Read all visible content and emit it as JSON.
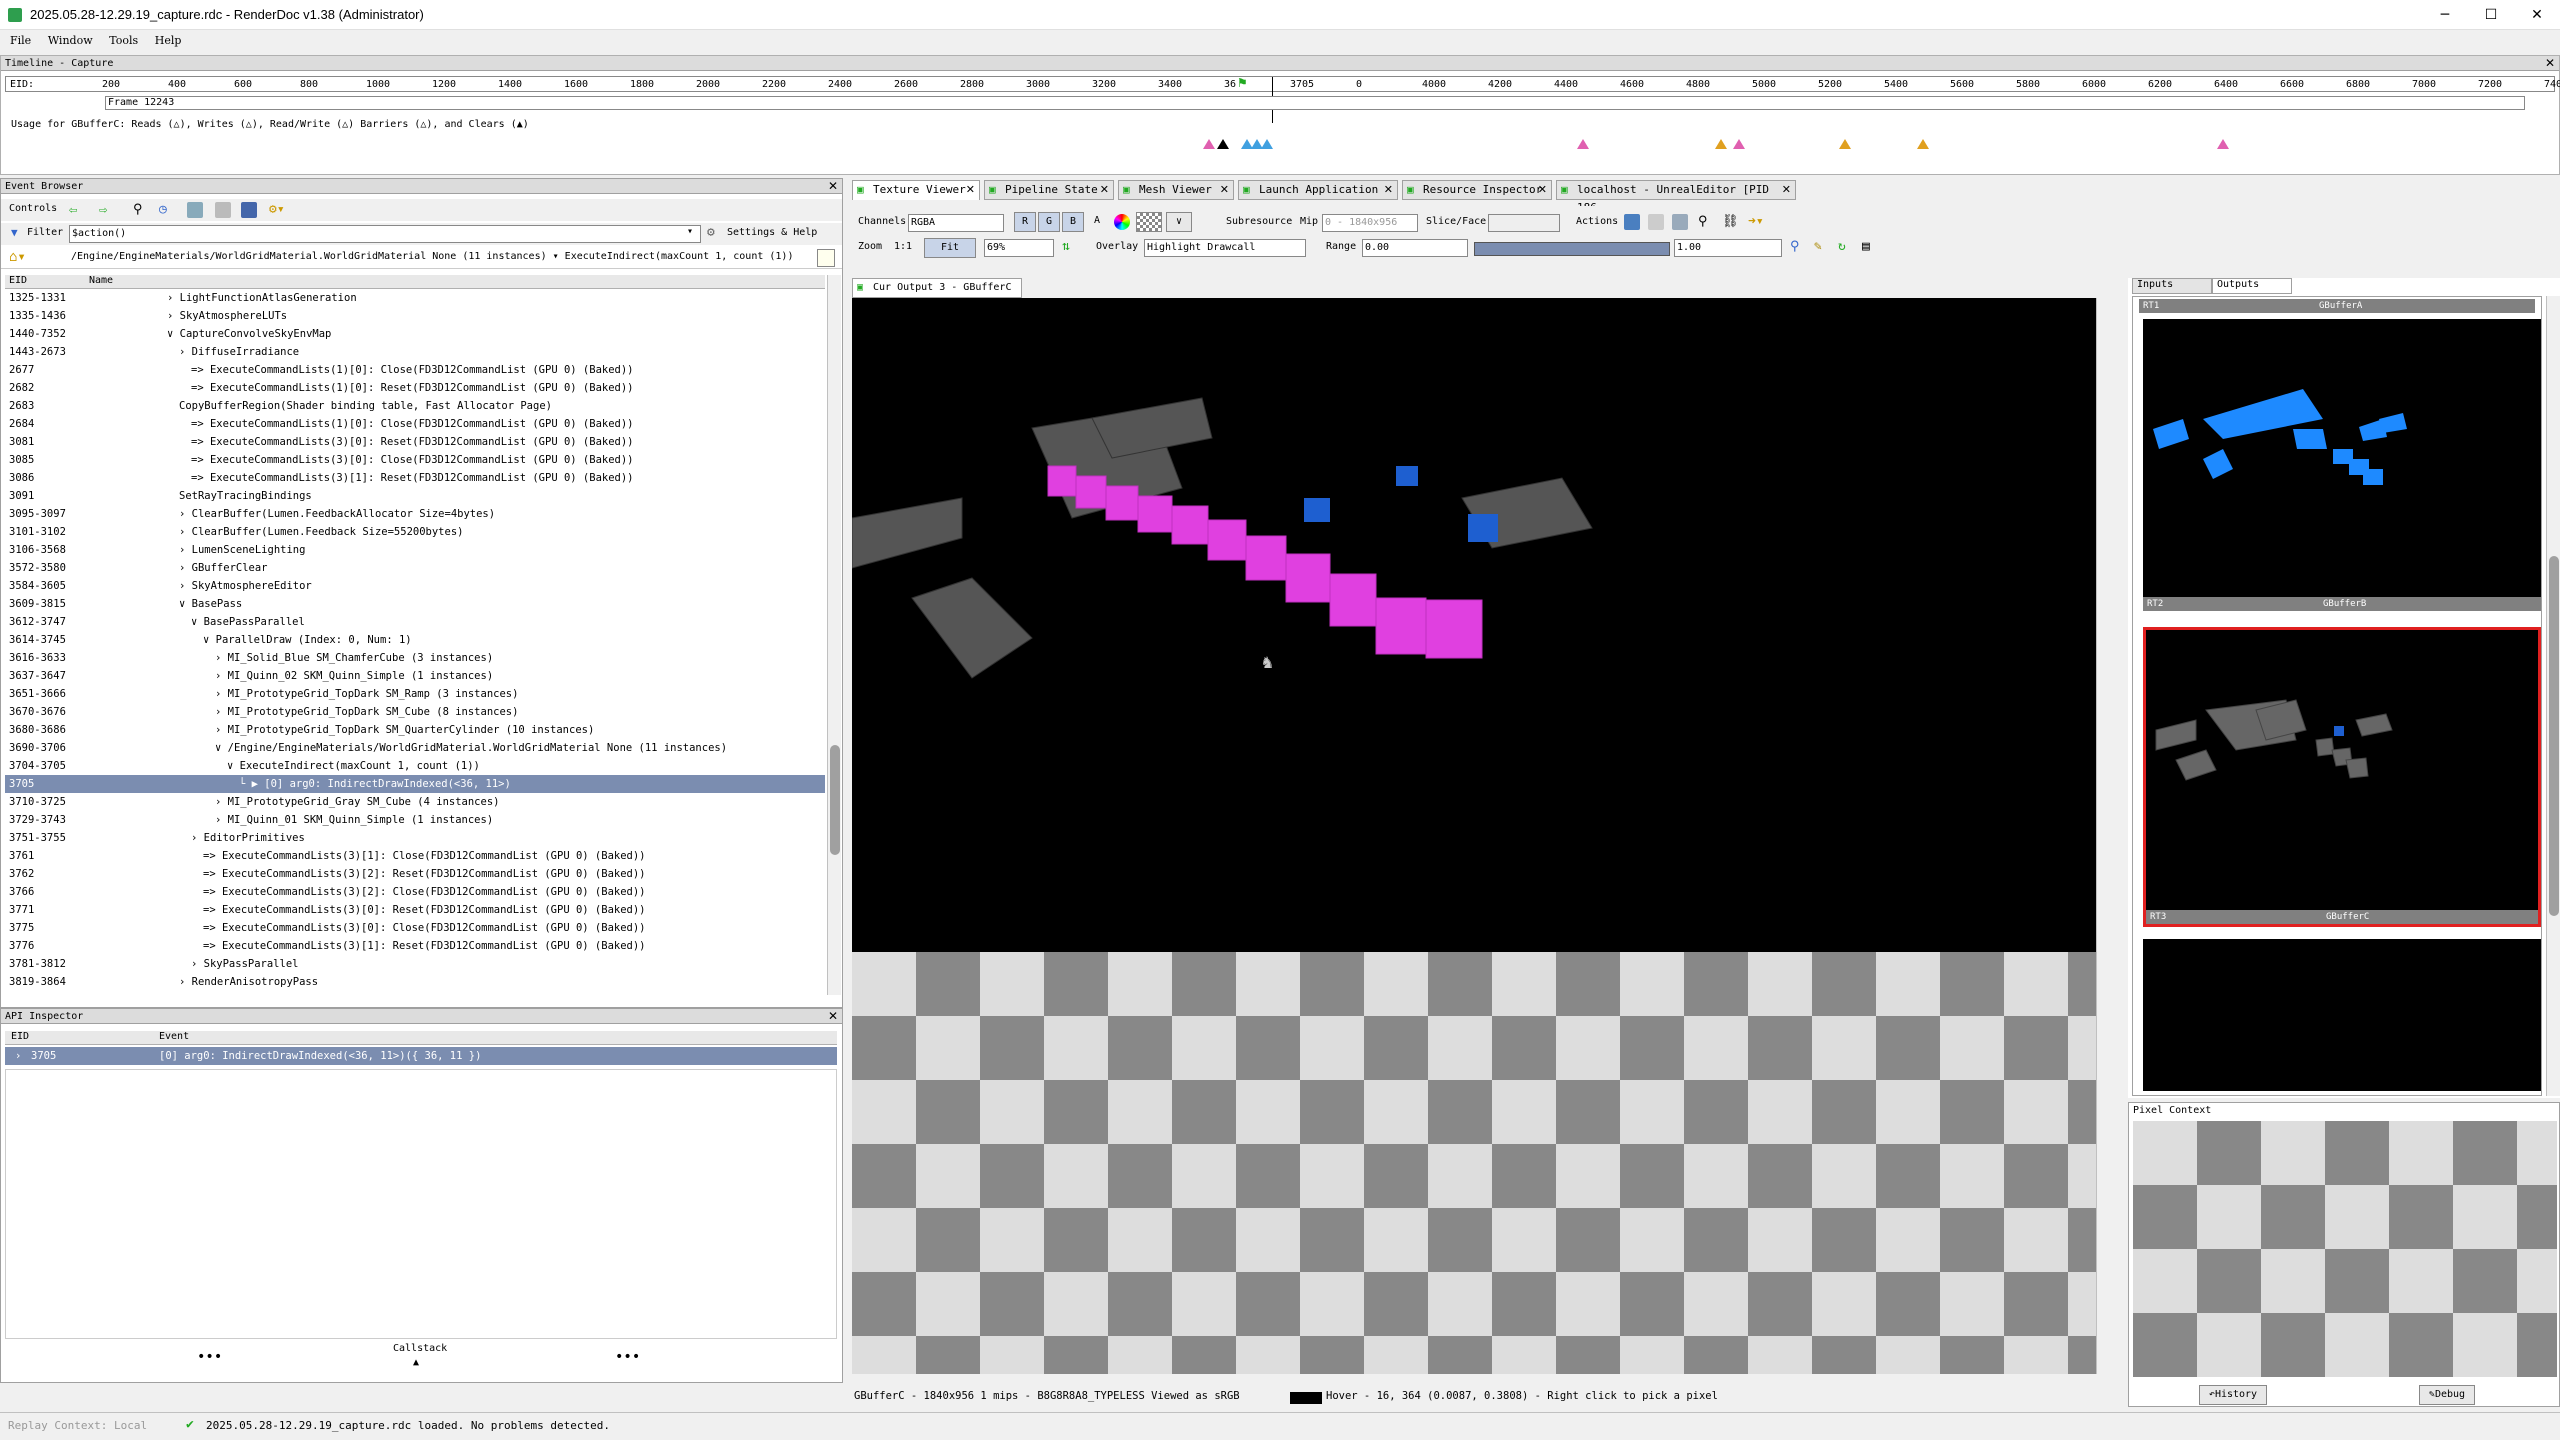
{
  "window": {
    "title": "2025.05.28-12.29.19_capture.rdc - RenderDoc v1.38 (Administrator)",
    "min": "─",
    "max": "☐",
    "close": "✕"
  },
  "menu": [
    "File",
    "Window",
    "Tools",
    "Help"
  ],
  "timeline": {
    "header": "Timeline - Capture",
    "eid_label": "EID:",
    "ticks": [
      "200",
      "400",
      "600",
      "800",
      "1000",
      "1200",
      "1400",
      "1600",
      "1800",
      "2000",
      "2200",
      "2400",
      "2600",
      "2800",
      "3000",
      "3200",
      "3400",
      "36",
      "3705",
      "0",
      "4000",
      "4200",
      "4400",
      "4600",
      "4800",
      "5000",
      "5200",
      "5400",
      "5600",
      "5800",
      "6000",
      "6200",
      "6400",
      "6600",
      "6800",
      "7000",
      "7200",
      "7400"
    ],
    "frame_label": "Frame 12243",
    "usage_text": "Usage for GBufferC: Reads (△), Writes (△), Read/Write (△) Barriers (△), and Clears (▲)"
  },
  "event_browser": {
    "header": "Event Browser",
    "controls_label": "Controls",
    "filter_label": "Filter",
    "filter_value": "$action()",
    "settings_label": "Settings & Help",
    "breadcrumb": "/Engine/EngineMaterials/WorldGridMaterial.WorldGridMaterial None (11 instances)  ▾  ExecuteIndirect(maxCount 1, count (1))",
    "col_eid": "EID",
    "col_name": "Name",
    "rows": [
      {
        "eid": "1325-1331",
        "name": "› LightFunctionAtlasGeneration",
        "indent": 1
      },
      {
        "eid": "1335-1436",
        "name": "› SkyAtmosphereLUTs",
        "indent": 1
      },
      {
        "eid": "1440-7352",
        "name": "∨ CaptureConvolveSkyEnvMap",
        "indent": 1
      },
      {
        "eid": "1443-2673",
        "name": "› DiffuseIrradiance",
        "indent": 2
      },
      {
        "eid": "2677",
        "name": "=>  ExecuteCommandLists(1)[0]:  Close(FD3D12CommandList (GPU 0) (Baked))",
        "indent": 3
      },
      {
        "eid": "2682",
        "name": "=>  ExecuteCommandLists(1)[0]:  Reset(FD3D12CommandList (GPU 0) (Baked))",
        "indent": 3
      },
      {
        "eid": "2683",
        "name": "CopyBufferRegion(Shader binding table,  Fast Allocator Page)",
        "indent": 2
      },
      {
        "eid": "2684",
        "name": "=>  ExecuteCommandLists(1)[0]:  Close(FD3D12CommandList (GPU 0) (Baked))",
        "indent": 3
      },
      {
        "eid": "3081",
        "name": "=>  ExecuteCommandLists(3)[0]:  Reset(FD3D12CommandList (GPU 0) (Baked))",
        "indent": 3
      },
      {
        "eid": "3085",
        "name": "=>  ExecuteCommandLists(3)[0]:  Close(FD3D12CommandList (GPU 0) (Baked))",
        "indent": 3
      },
      {
        "eid": "3086",
        "name": "=>  ExecuteCommandLists(3)[1]:  Reset(FD3D12CommandList (GPU 0) (Baked))",
        "indent": 3
      },
      {
        "eid": "3091",
        "name": "SetRayTracingBindings",
        "indent": 2
      },
      {
        "eid": "3095-3097",
        "name": "› ClearBuffer(Lumen.FeedbackAllocator Size=4bytes)",
        "indent": 2
      },
      {
        "eid": "3101-3102",
        "name": "› ClearBuffer(Lumen.Feedback Size=55200bytes)",
        "indent": 2
      },
      {
        "eid": "3106-3568",
        "name": "› LumenSceneLighting",
        "indent": 2
      },
      {
        "eid": "3572-3580",
        "name": "› GBufferClear",
        "indent": 2
      },
      {
        "eid": "3584-3605",
        "name": "› SkyAtmosphereEditor",
        "indent": 2
      },
      {
        "eid": "3609-3815",
        "name": "∨ BasePass",
        "indent": 2
      },
      {
        "eid": "3612-3747",
        "name": "∨ BasePassParallel",
        "indent": 3
      },
      {
        "eid": "3614-3745",
        "name": "∨ ParallelDraw (Index: 0, Num: 1)",
        "indent": 4
      },
      {
        "eid": "3616-3633",
        "name": "› MI_Solid_Blue SM_ChamferCube (3 instances)",
        "indent": 5
      },
      {
        "eid": "3637-3647",
        "name": "› MI_Quinn_02 SKM_Quinn_Simple (1 instances)",
        "indent": 5
      },
      {
        "eid": "3651-3666",
        "name": "› MI_PrototypeGrid_TopDark SM_Ramp (3 instances)",
        "indent": 5
      },
      {
        "eid": "3670-3676",
        "name": "› MI_PrototypeGrid_TopDark SM_Cube (8 instances)",
        "indent": 5
      },
      {
        "eid": "3680-3686",
        "name": "› MI_PrototypeGrid_TopDark SM_QuarterCylinder (10 instances)",
        "indent": 5
      },
      {
        "eid": "3690-3706",
        "name": "∨ /Engine/EngineMaterials/WorldGridMaterial.WorldGridMaterial None (11 instances)",
        "indent": 5
      },
      {
        "eid": "3704-3705",
        "name": "∨ ExecuteIndirect(maxCount 1, count (1))",
        "indent": 6
      },
      {
        "eid": "3705",
        "name": "└ ▶ [0] arg0: IndirectDrawIndexed(<36, 11>)",
        "indent": 7,
        "selected": true
      },
      {
        "eid": "3710-3725",
        "name": "› MI_PrototypeGrid_Gray SM_Cube (4 instances)",
        "indent": 5
      },
      {
        "eid": "3729-3743",
        "name": "› MI_Quinn_01 SKM_Quinn_Simple (1 instances)",
        "indent": 5
      },
      {
        "eid": "3751-3755",
        "name": "› EditorPrimitives",
        "indent": 3
      },
      {
        "eid": "3761",
        "name": "=>  ExecuteCommandLists(3)[1]:  Close(FD3D12CommandList (GPU 0) (Baked))",
        "indent": 4
      },
      {
        "eid": "3762",
        "name": "=>  ExecuteCommandLists(3)[2]:  Reset(FD3D12CommandList (GPU 0) (Baked))",
        "indent": 4
      },
      {
        "eid": "3766",
        "name": "=>  ExecuteCommandLists(3)[2]:  Close(FD3D12CommandList (GPU 0) (Baked))",
        "indent": 4
      },
      {
        "eid": "3771",
        "name": "=>  ExecuteCommandLists(3)[0]:  Reset(FD3D12CommandList (GPU 0) (Baked))",
        "indent": 4
      },
      {
        "eid": "3775",
        "name": "=>  ExecuteCommandLists(3)[0]:  Close(FD3D12CommandList (GPU 0) (Baked))",
        "indent": 4
      },
      {
        "eid": "3776",
        "name": "=>  ExecuteCommandLists(3)[1]:  Reset(FD3D12CommandList (GPU 0) (Baked))",
        "indent": 4
      },
      {
        "eid": "3781-3812",
        "name": "› SkyPassParallel",
        "indent": 3
      },
      {
        "eid": "3819-3864",
        "name": "› RenderAnisotropyPass",
        "indent": 2
      }
    ]
  },
  "api_inspector": {
    "header": "API Inspector",
    "col_eid": "EID",
    "col_event": "Event",
    "row_eid": "3705",
    "row_event": "[0] arg0: IndirectDrawIndexed(<36, 11>)({ 36, 11 })",
    "callstack": "Callstack",
    "dots": "•••"
  },
  "tabs": [
    {
      "label": "Texture Viewer",
      "active": true
    },
    {
      "label": "Pipeline State"
    },
    {
      "label": "Mesh Viewer"
    },
    {
      "label": "Launch Application"
    },
    {
      "label": "Resource Inspector"
    },
    {
      "label": "localhost - UnrealEditor [PID 186…"
    }
  ],
  "texture_viewer": {
    "channels_label": "Channels",
    "channels_value": "RGBA",
    "chan_r": "R",
    "chan_g": "G",
    "chan_b": "B",
    "chan_a": "A",
    "subresource_label": "Subresource",
    "mip_label": "Mip",
    "mip_value": "0 - 1840x956",
    "slice_label": "Slice/Face",
    "actions_label": "Actions",
    "zoom_label": "Zoom",
    "zoom_1to1": "1:1",
    "fit_label": "Fit",
    "zoom_value": "69%",
    "overlay_label": "Overlay",
    "overlay_value": "Highlight Drawcall",
    "range_label": "Range",
    "range_min": "0.00",
    "range_max": "1.00",
    "output_tab": "Cur Output 3 - GBufferC",
    "status": "GBufferC - 1840x956 1 mips - B8G8R8A8_TYPELESS Viewed as sRGB",
    "hover": "Hover -     16,  364 (0.0087, 0.3808)  - Right click to pick a pixel"
  },
  "right_panel": {
    "inputs_tab": "Inputs",
    "outputs_tab": "Outputs",
    "thumbs": [
      {
        "slot": "RT1",
        "name": "GBufferA"
      },
      {
        "slot": "RT2",
        "name": "GBufferB"
      },
      {
        "slot": "RT3",
        "name": "GBufferC",
        "selected": true
      }
    ],
    "pixel_context": "Pixel Context",
    "history_btn": "History",
    "debug_btn": "Debug"
  },
  "statusbar": {
    "replay": "Replay Context: Local",
    "message": "2025.05.28-12.29.19_capture.rdc loaded. No problems detected."
  },
  "colors": {
    "selection": "#7b8db0",
    "highlight": "#e040e0",
    "blue": "#1e7ef0",
    "accent_red": "#e02020"
  }
}
